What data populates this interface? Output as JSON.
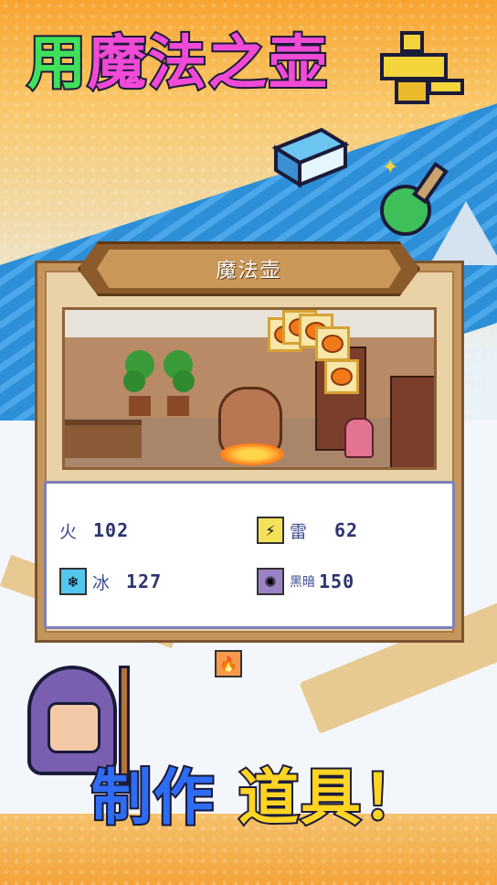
{
  "headline": {
    "part1": "用",
    "part2": "魔法之壶"
  },
  "panel": {
    "title": "魔法壶"
  },
  "stats": [
    {
      "element": "火",
      "value": "102",
      "icon": "fire-icon"
    },
    {
      "element": "雷",
      "value": "62",
      "icon": "thunder-icon"
    },
    {
      "element": "冰",
      "value": "127",
      "icon": "ice-icon"
    },
    {
      "element": "黑暗",
      "value": "150",
      "icon": "dark-icon"
    }
  ],
  "footline": {
    "part1": "制作",
    "part2": "道具！"
  },
  "colors": {
    "headline_green": "#3fe05a",
    "headline_pink": "#f04ad6",
    "footline_blue": "#2e6cf2",
    "footline_yellow": "#ffd423"
  }
}
